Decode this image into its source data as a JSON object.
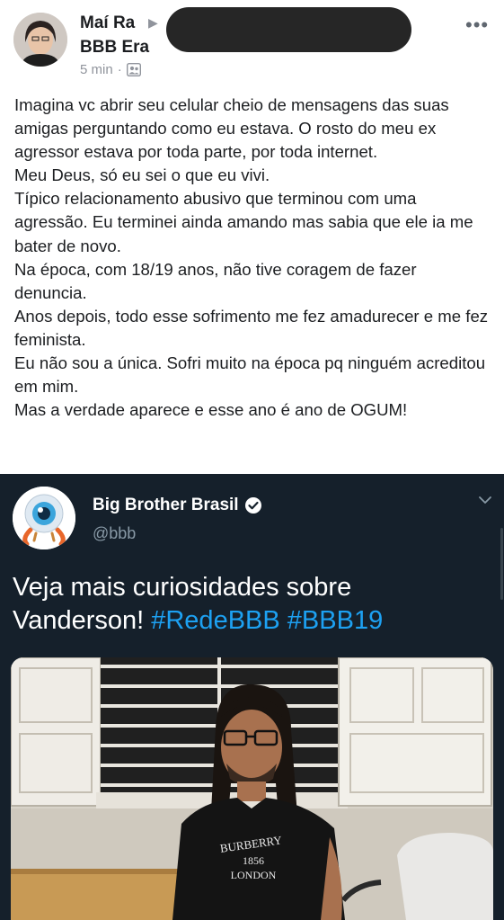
{
  "facebook_post": {
    "author": "Maí Ra",
    "group": "BBB Era",
    "time": "5 min",
    "separator": "·",
    "more_label": "•••",
    "arrow": "▶",
    "privacy_icon": "group-privacy-icon",
    "paragraphs": [
      "Imagina vc abrir seu celular cheio de mensagens das suas amigas perguntando como eu estava. O rosto do meu ex agressor estava por toda parte, por toda internet.",
      "Meu Deus, só eu sei o que eu vivi.",
      "Típico relacionamento abusivo que terminou com uma agressão. Eu terminei ainda amando mas sabia que ele ia me bater de novo.",
      "Na época, com 18/19 anos, não tive coragem de fazer denuncia.",
      "Anos depois, todo esse sofrimento me fez amadurecer e me fez feminista.",
      "Eu não sou a única. Sofri muito na época pq ninguém acreditou em mim.",
      "Mas a verdade aparece e esse ano é ano de OGUM!"
    ]
  },
  "tweet": {
    "name": "Big Brother Brasil",
    "handle": "@bbb",
    "text_plain": "Veja mais curiosidades sobre Vanderson! ",
    "hashtag_1": "#RedeBBB",
    "hashtag_2": "#BBB19",
    "shirt_text_1": "BURBERRY",
    "shirt_text_2": "1856",
    "shirt_text_3": "LONDON"
  },
  "colors": {
    "fb_text": "#1c1e21",
    "fb_meta": "#90949c",
    "tw_background": "#15202b",
    "tw_link": "#1da1f2",
    "tw_handle": "#8899a6"
  }
}
